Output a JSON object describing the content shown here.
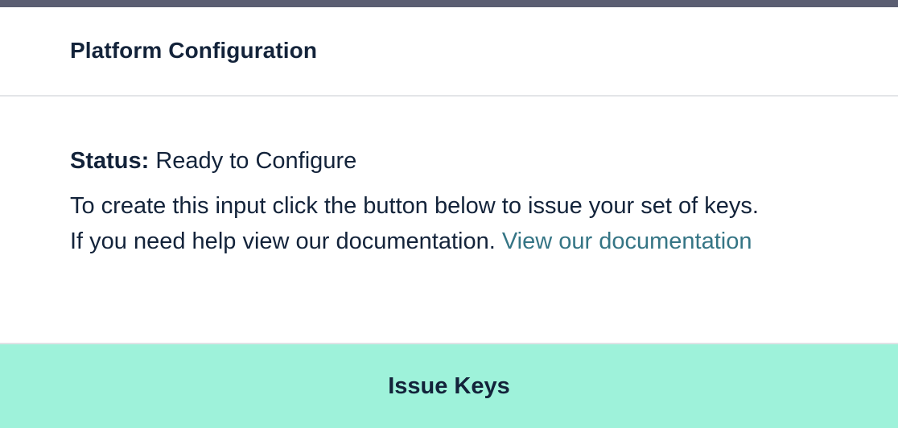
{
  "header": {
    "title": "Platform Configuration"
  },
  "status": {
    "label": "Status:",
    "value": "Ready to Configure"
  },
  "description": {
    "line1": "To create this input click the button below to issue your set of keys.",
    "line2": "If you need help view our documentation.",
    "link_text": "View our documentation"
  },
  "action": {
    "button_label": "Issue Keys"
  },
  "colors": {
    "top_bar": "#5b5e72",
    "text": "#13233a",
    "link": "#357585",
    "button_bg": "#9ef2da"
  }
}
